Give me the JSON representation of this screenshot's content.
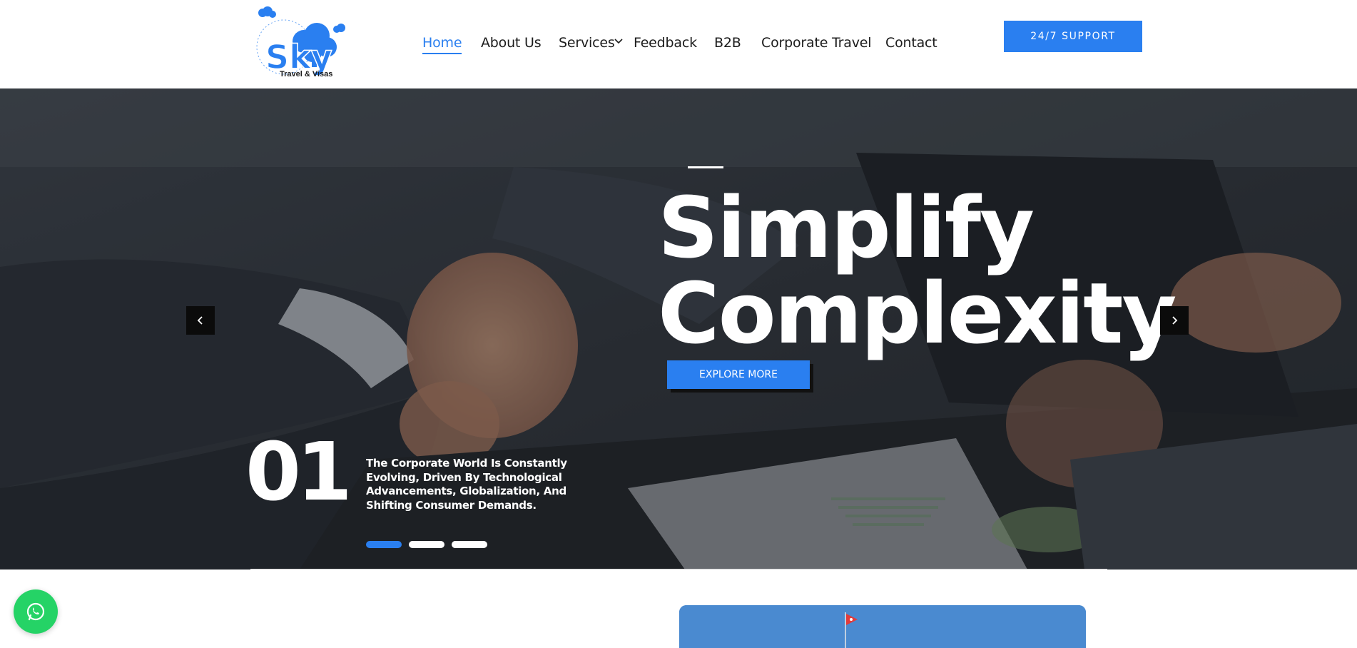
{
  "header": {
    "logo": {
      "name": "Sky",
      "caption": "Travel & Visas"
    },
    "nav": [
      {
        "label": "Home"
      },
      {
        "label": "About Us"
      },
      {
        "label": "Services"
      },
      {
        "label": "Feedback"
      },
      {
        "label": "B2B"
      },
      {
        "label": "Corporate Travel"
      },
      {
        "label": "Contact"
      }
    ],
    "support_label": "24/7 SUPPORT"
  },
  "hero": {
    "title_line1": "Simplify",
    "title_line2": "Complexity",
    "cta_label": "EXPLORE MORE",
    "slide_number": "01",
    "description": "The Corporate World Is Constantly Evolving, Driven By Technological Advancements, Globalization, And Shifting Consumer Demands.",
    "slides_total": 3,
    "active_slide": 1
  },
  "colors": {
    "accent": "#2a7ff0",
    "whatsapp": "#25d366",
    "text_dark": "#1c1c1c",
    "hero_overlay": "#34393f"
  },
  "icons": {
    "prev": "chevron-left-icon",
    "next": "chevron-right-icon",
    "services_dropdown": "chevron-down-icon",
    "whatsapp": "whatsapp-icon"
  }
}
